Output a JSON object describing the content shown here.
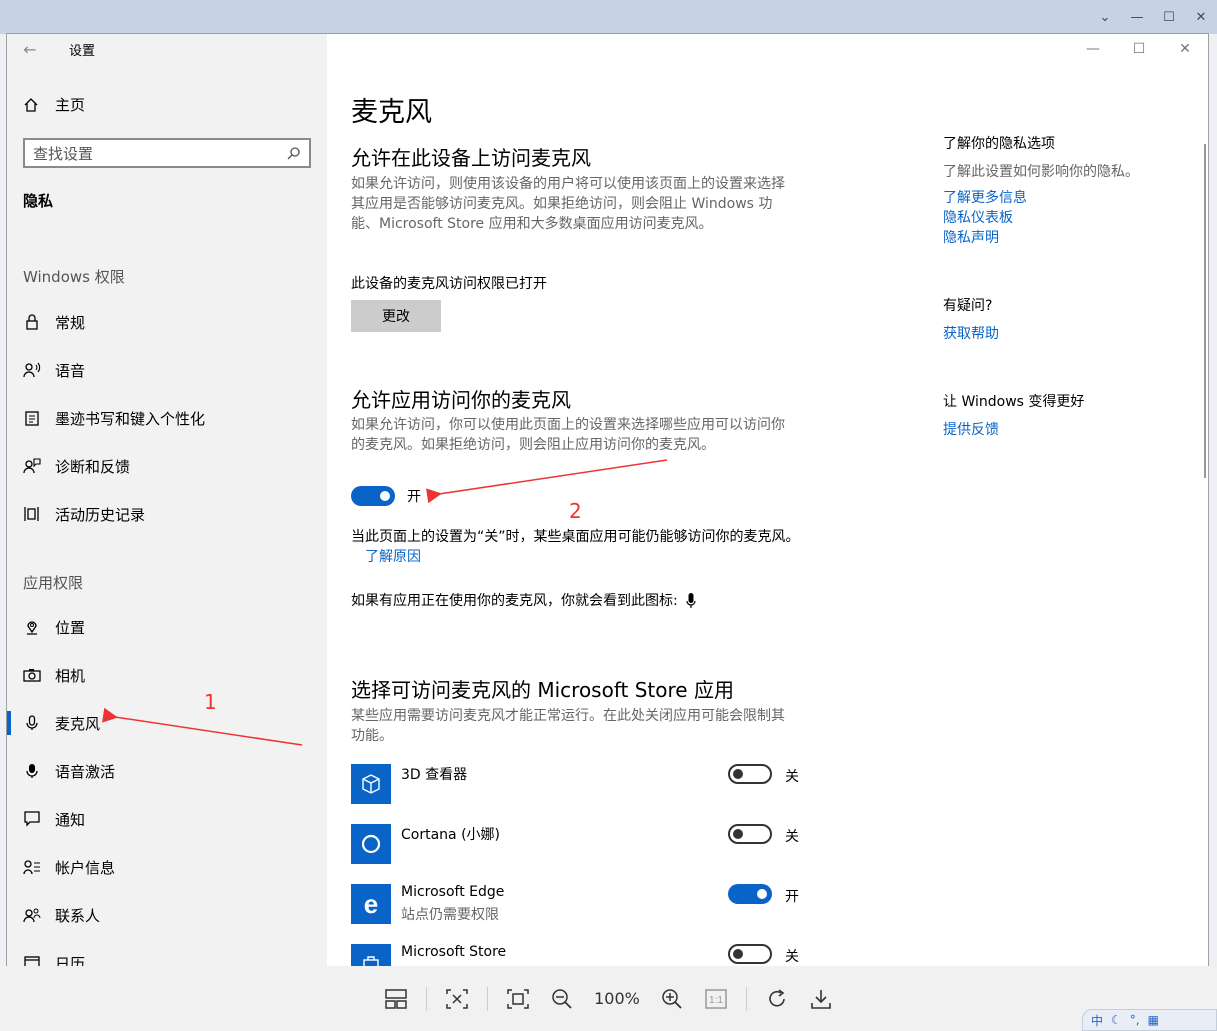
{
  "sidebar": {
    "title": "设置",
    "home": "主页",
    "search_placeholder": "查找设置",
    "section": "隐私",
    "group_windows": "Windows 权限",
    "windows_items": [
      "常规",
      "语音",
      "墨迹书写和键入个性化",
      "诊断和反馈",
      "活动历史记录"
    ],
    "group_apps": "应用权限",
    "app_items": [
      "位置",
      "相机",
      "麦克风",
      "语音激活",
      "通知",
      "帐户信息",
      "联系人",
      "日历"
    ]
  },
  "main": {
    "title": "麦克风",
    "section1_title": "允许在此设备上访问麦克风",
    "section1_desc": "如果允许访问，则使用该设备的用户将可以使用该页面上的设置来选择其应用是否能够访问麦克风。如果拒绝访问，则会阻止 Windows 功能、Microsoft Store 应用和大多数桌面应用访问麦克风。",
    "device_status": "此设备的麦克风访问权限已打开",
    "change_button": "更改",
    "section2_title": "允许应用访问你的麦克风",
    "section2_desc": "如果允许访问，你可以使用此页面上的设置来选择哪些应用可以访问你的麦克风。如果拒绝访问，则会阻止应用访问你的麦克风。",
    "apps_toggle_label": "开",
    "desktop_note": "当此页面上的设置为“关”时，某些桌面应用可能仍能够访问你的麦克风。",
    "learn_why": "了解原因",
    "icon_note": "如果有应用正在使用你的麦克风，你就会看到此图标:",
    "section3_title": "选择可访问麦克风的 Microsoft Store 应用",
    "section3_desc": "某些应用需要访问麦克风才能正常运行。在此处关闭应用可能会限制其功能。",
    "apps": [
      {
        "name": "3D 查看器",
        "sub": "",
        "state": "关",
        "on": false
      },
      {
        "name": "Cortana (小娜)",
        "sub": "",
        "state": "关",
        "on": false
      },
      {
        "name": "Microsoft Edge",
        "sub": "站点仍需要权限",
        "state": "开",
        "on": true
      },
      {
        "name": "Microsoft Store",
        "sub": "",
        "state": "关",
        "on": false
      }
    ]
  },
  "aside": {
    "privacy_title": "了解你的隐私选项",
    "privacy_desc": "了解此设置如何影响你的隐私。",
    "link1": "了解更多信息",
    "link2": "隐私仪表板",
    "link3": "隐私声明",
    "question_title": "有疑问?",
    "help_link": "获取帮助",
    "improve_title": "让 Windows 变得更好",
    "feedback_link": "提供反馈"
  },
  "annotations": {
    "one": "1",
    "two": "2"
  },
  "viewer": {
    "zoom": "100%"
  },
  "tray": {
    "ime": "中"
  }
}
